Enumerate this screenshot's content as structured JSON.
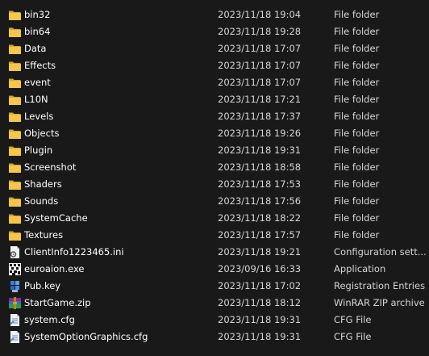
{
  "files": [
    {
      "name": "bin32",
      "date": "2023/11/18 19:04",
      "type": "File folder",
      "icon": "folder-icon"
    },
    {
      "name": "bin64",
      "date": "2023/11/18 19:28",
      "type": "File folder",
      "icon": "folder-icon"
    },
    {
      "name": "Data",
      "date": "2023/11/18 17:07",
      "type": "File folder",
      "icon": "folder-icon"
    },
    {
      "name": "Effects",
      "date": "2023/11/18 17:07",
      "type": "File folder",
      "icon": "folder-icon"
    },
    {
      "name": "event",
      "date": "2023/11/18 17:07",
      "type": "File folder",
      "icon": "folder-icon"
    },
    {
      "name": "L10N",
      "date": "2023/11/18 17:21",
      "type": "File folder",
      "icon": "folder-icon"
    },
    {
      "name": "Levels",
      "date": "2023/11/18 17:37",
      "type": "File folder",
      "icon": "folder-icon"
    },
    {
      "name": "Objects",
      "date": "2023/11/18 19:26",
      "type": "File folder",
      "icon": "folder-icon"
    },
    {
      "name": "Plugin",
      "date": "2023/11/18 19:31",
      "type": "File folder",
      "icon": "folder-icon"
    },
    {
      "name": "Screenshot",
      "date": "2023/11/18 18:58",
      "type": "File folder",
      "icon": "folder-icon"
    },
    {
      "name": "Shaders",
      "date": "2023/11/18 17:53",
      "type": "File folder",
      "icon": "folder-icon"
    },
    {
      "name": "Sounds",
      "date": "2023/11/18 17:56",
      "type": "File folder",
      "icon": "folder-icon"
    },
    {
      "name": "SystemCache",
      "date": "2023/11/18 18:22",
      "type": "File folder",
      "icon": "folder-icon"
    },
    {
      "name": "Textures",
      "date": "2023/11/18 17:57",
      "type": "File folder",
      "icon": "folder-icon"
    },
    {
      "name": "ClientInfo1223465.ini",
      "date": "2023/11/18 19:21",
      "type": "Configuration sett...",
      "icon": "config-settings-icon"
    },
    {
      "name": "euroaion.exe",
      "date": "2023/09/16 16:33",
      "type": "Application",
      "icon": "application-icon"
    },
    {
      "name": "Pub.key",
      "date": "2023/11/18 17:02",
      "type": "Registration Entries",
      "icon": "registry-icon"
    },
    {
      "name": "StartGame.zip",
      "date": "2023/11/18 18:12",
      "type": "WinRAR ZIP archive",
      "icon": "winrar-archive-icon"
    },
    {
      "name": "system.cfg",
      "date": "2023/11/18 19:31",
      "type": "CFG File",
      "icon": "cfg-file-icon"
    },
    {
      "name": "SystemOptionGraphics.cfg",
      "date": "2023/11/18 19:31",
      "type": "CFG File",
      "icon": "cfg-file-icon"
    }
  ],
  "colors": {
    "background": "#191919",
    "folder": "#f0c240",
    "text": "#ffffff",
    "secondary_text": "#d6d6d6"
  }
}
